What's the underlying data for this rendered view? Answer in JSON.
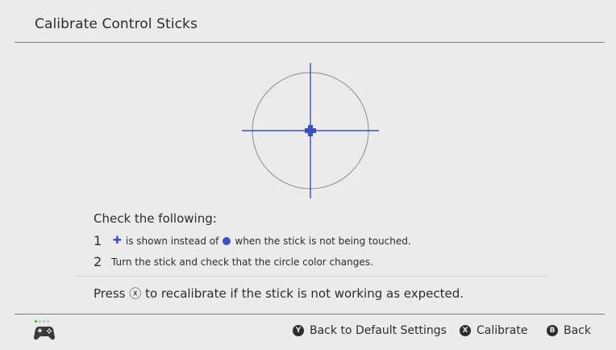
{
  "header": {
    "title": "Calibrate Control Sticks"
  },
  "instructions": {
    "heading": "Check the following:",
    "step1_number": "1",
    "step1_part_a": "is shown instead of",
    "step1_part_b": "when the stick is not being touched.",
    "step2_number": "2",
    "step2_text": "Turn the stick and check that the circle color changes.",
    "press_a": "Press",
    "press_symbol": "ⓧ",
    "press_b": "to recalibrate if the stick is not working as expected."
  },
  "footer": {
    "y_glyph": "Y",
    "y_label": "Back to Default Settings",
    "x_glyph": "X",
    "x_label": "Calibrate",
    "b_glyph": "B",
    "b_label": "Back"
  },
  "colors": {
    "accent": "#3b4fc4",
    "background": "#ebebeb",
    "text": "#2d2d2d"
  },
  "icons": {
    "controller": "controller-icon",
    "plus_marker": "plus-icon",
    "dot_marker": "dot-icon"
  }
}
